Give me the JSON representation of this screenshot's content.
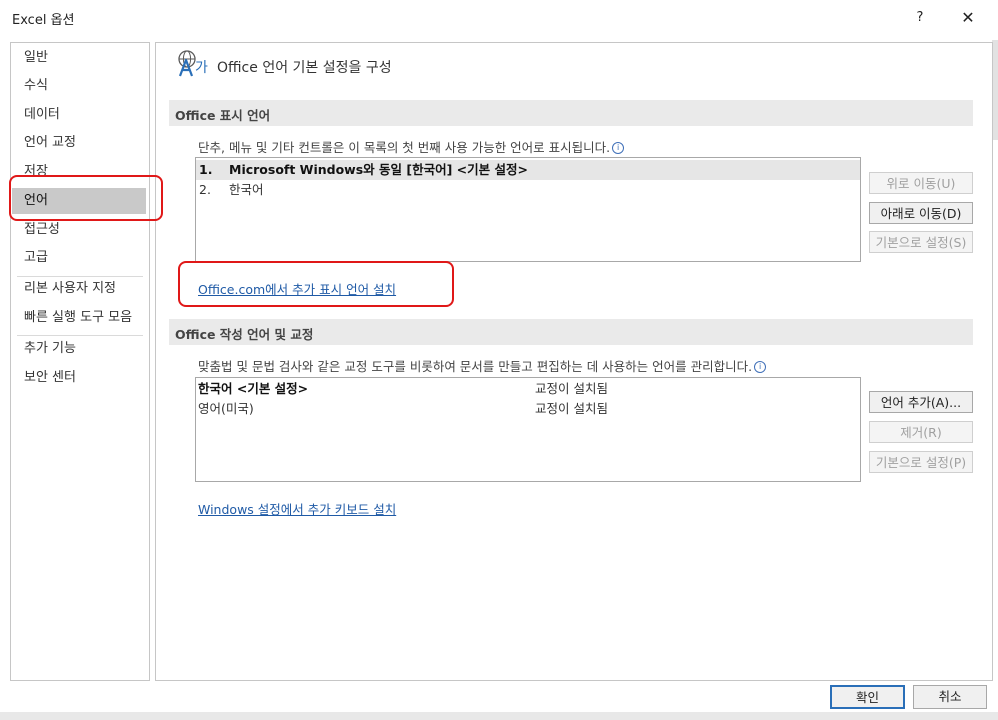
{
  "window": {
    "title": "Excel 옵션",
    "help": "?",
    "close": "✕"
  },
  "sidebar": {
    "items": [
      {
        "label": "일반"
      },
      {
        "label": "수식"
      },
      {
        "label": "데이터"
      },
      {
        "label": "언어 교정"
      },
      {
        "label": "저장"
      },
      {
        "label": "언어"
      },
      {
        "label": "접근성"
      },
      {
        "label": "고급"
      },
      {
        "label": "리본 사용자 지정"
      },
      {
        "label": "빠른 실행 도구 모음"
      },
      {
        "label": "추가 기능"
      },
      {
        "label": "보안 센터"
      }
    ],
    "selected": "언어"
  },
  "main": {
    "icon_glyph": "가",
    "title": "Office 언어 기본 설정을 구성",
    "display": {
      "header": "Office 표시 언어",
      "description": "단추, 메뉴 및 기타 컨트롤은 이 목록의 첫 번째 사용 가능한 언어로 표시됩니다.",
      "languages": [
        {
          "num": "1.",
          "name": "Microsoft Windows와 동일 [한국어] <기본 설정>"
        },
        {
          "num": "2.",
          "name": "한국어"
        }
      ],
      "buttons": {
        "up": "위로 이동(U)",
        "down": "아래로 이동(D)",
        "default": "기본으로 설정(S)"
      },
      "link": "Office.com에서 추가 표시 언어 설치"
    },
    "authoring": {
      "header": "Office 작성 언어 및 교정",
      "description": "맞춤법 및 문법 검사와 같은 교정 도구를 비롯하여 문서를 만들고 편집하는 데 사용하는 언어를 관리합니다.",
      "languages": [
        {
          "name": "한국어 <기본 설정>",
          "status": "교정이 설치됨"
        },
        {
          "name": "영어(미국)",
          "status": "교정이 설치됨"
        }
      ],
      "buttons": {
        "add": "언어 추가(A)...",
        "remove": "제거(R)",
        "default": "기본으로 설정(P)"
      },
      "link": "Windows 설정에서 추가 키보드 설치"
    }
  },
  "footer": {
    "ok": "확인",
    "cancel": "취소"
  },
  "colors": {
    "accent": "#2a6fb8",
    "link": "#1f5aa6",
    "annotation": "#e01818",
    "selected_bg": "#c9c9c9"
  }
}
